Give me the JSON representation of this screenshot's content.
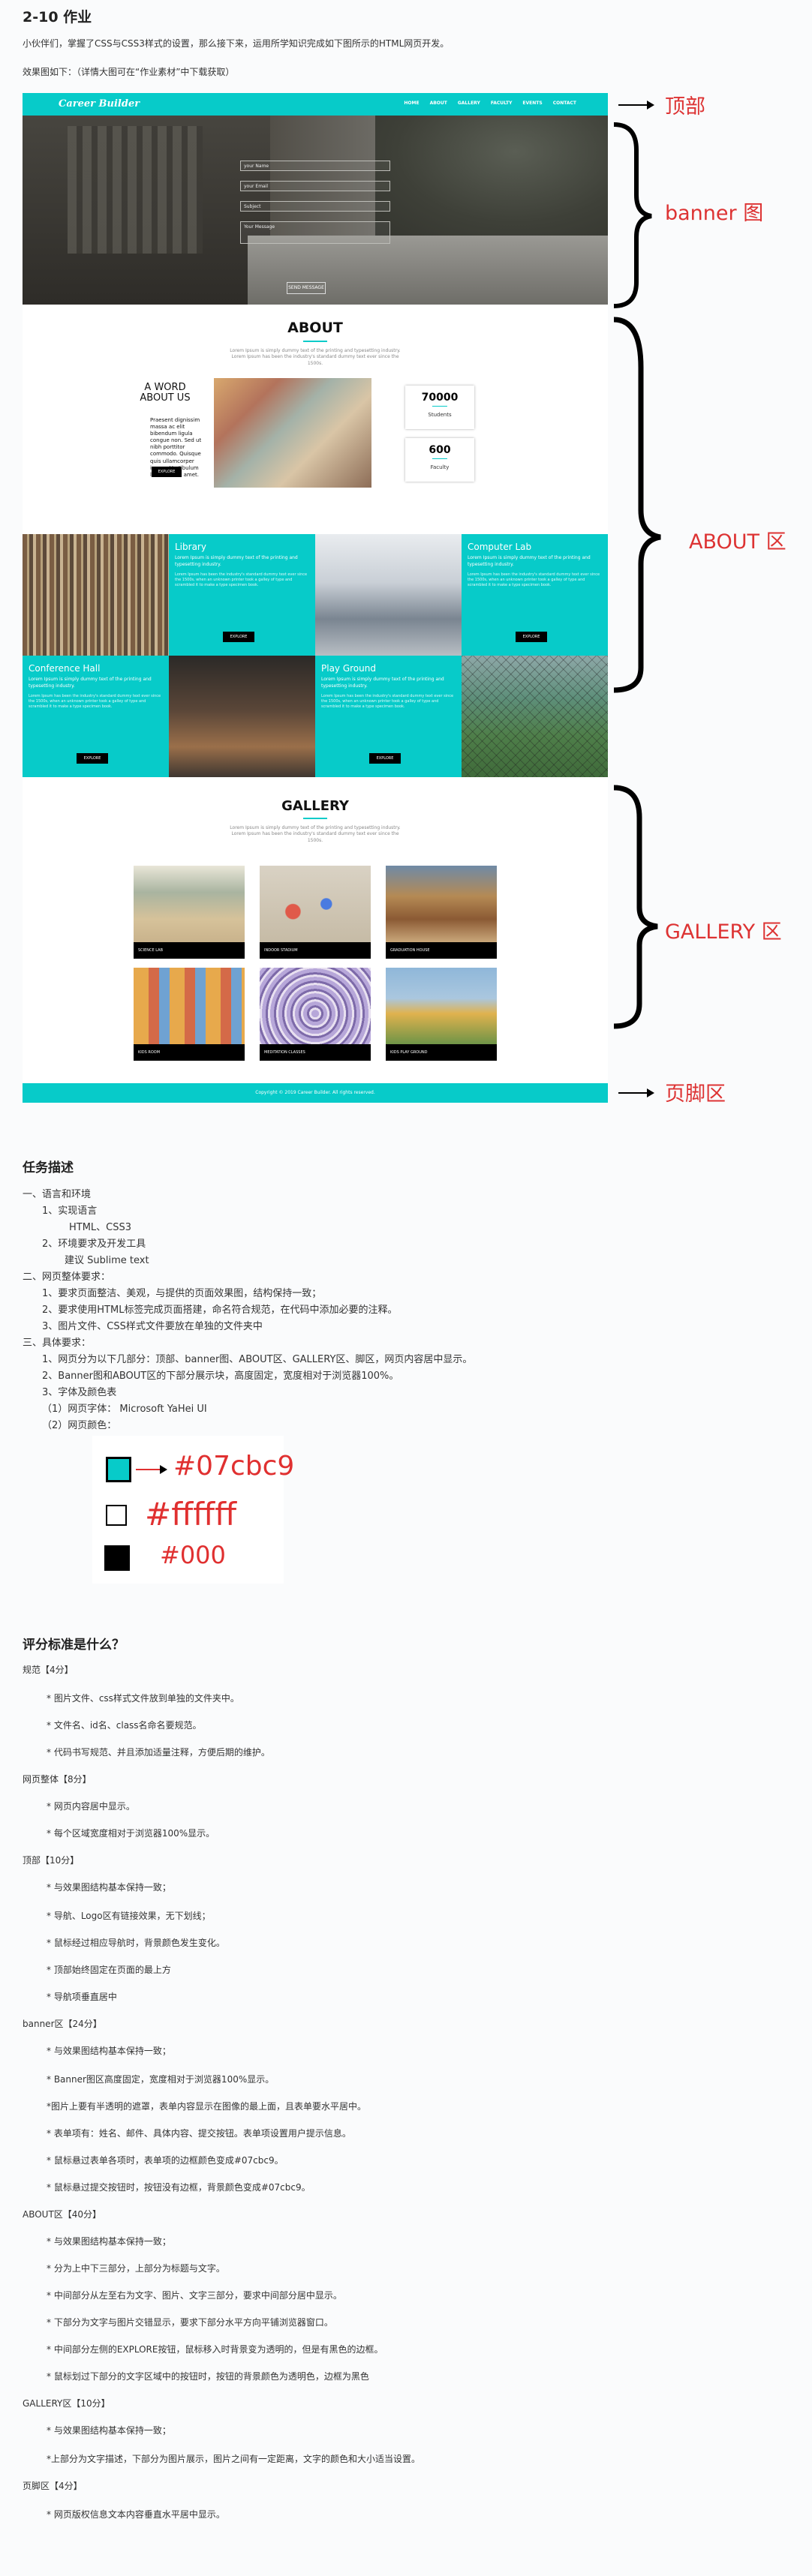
{
  "title": "2-10 作业",
  "intro": "小伙伴们，掌握了CSS与CSS3样式的设置，那么接下来，运用所学知识完成如下图所示的HTML网页开发。",
  "effect_label": "效果图如下：（详情大图可在“作业素材”中下载获取）",
  "mock": {
    "logo": "Career Builder",
    "nav": [
      "HOME",
      "ABOUT",
      "GALLERY",
      "FACULTY",
      "EVENTS",
      "CONTACT"
    ],
    "banner_fields": [
      "your Name",
      "your Email",
      "Subject",
      "Your Message"
    ],
    "banner_submit": "SEND MESSAGE",
    "about_title": "ABOUT",
    "about_sub": "Lorem Ipsum is simply dummy text of the printing and typesetting industry. Lorem Ipsum has been the industry's standard dummy text ever since the 1500s.",
    "word_title": "A WORD ABOUT US",
    "word_text": "Praesent dignissim massa ac elit bibendum ligula congue non. Sed ut nibh porttitor commodo. Quisque quis ullamcorper ipsum. Vestibulum lacinia diam amet.",
    "explore": "EXPLORE",
    "stats": [
      {
        "num": "70000",
        "label": "Students"
      },
      {
        "num": "600",
        "label": "Faculty"
      }
    ],
    "cells": [
      {
        "title": "Library",
        "sub": "Lorem Ipsum is simply dummy text of the printing and typesetting industry.",
        "para": "Lorem Ipsum has been the industry's standard dummy text ever since the 1500s, when an unknown printer took a galley of type and scrambled it to make a type specimen book.",
        "btn": "EXPLORE"
      },
      {
        "title": "Computer Lab",
        "sub": "Lorem Ipsum is simply dummy text of the printing and typesetting industry.",
        "para": "Lorem Ipsum has been the industry's standard dummy text ever since the 1500s, when an unknown printer took a galley of type and scrambled it to make a type specimen book.",
        "btn": "EXPLORE"
      },
      {
        "title": "Conference Hall",
        "sub": "Lorem Ipsum is simply dummy text of the printing and typesetting industry.",
        "para": "Lorem Ipsum has been the industry's standard dummy text ever since the 1500s, when an unknown printer took a galley of type and scrambled it to make a type specimen book.",
        "btn": "EXPLORE"
      },
      {
        "title": "Play Ground",
        "sub": "Lorem Ipsum is simply dummy text of the printing and typesetting industry.",
        "para": "Lorem Ipsum has been the industry's standard dummy text ever since the 1500s, when an unknown printer took a galley of type and scrambled it to make a type specimen book.",
        "btn": "EXPLORE"
      }
    ],
    "gallery_title": "GALLERY",
    "gallery_sub": "Lorem Ipsum is simply dummy text of the printing and typesetting industry. Lorem Ipsum has been the industry's standard dummy text ever since the 1500s.",
    "gallery": [
      "SCIENCE LAB",
      "INDOOR STADIUM",
      "GRADUATION HOUSE",
      "KIDS ROOM",
      "MEDITATION CLASSES",
      "KIDS PLAY GROUND"
    ],
    "footer": "Copyright © 2019 Career Builder. All rights reserved."
  },
  "annotations": {
    "top": "顶部",
    "banner": "banner 图",
    "about": "ABOUT 区",
    "gallery": "GALLERY 区",
    "footer": "页脚区"
  },
  "task": {
    "heading": "任务描述",
    "lines": [
      "一、语言和环境",
      "1、实现语言",
      "HTML、CSS3",
      "2、环境要求及开发工具",
      "建议 Sublime text",
      "二、网页整体要求：",
      "1、要求页面整洁、美观，与提供的页面效果图，结构保持一致；",
      "2、要求使用HTML标签完成页面搭建，命名符合规范，在代码中添加必要的注释。",
      "3、图片文件、CSS样式文件要放在单独的文件夹中",
      "三、具体要求：",
      "1、网页分为以下几部分：顶部、banner图、ABOUT区、GALLERY区、脚区，网页内容居中显示。",
      "2、Banner图和ABOUT区的下部分展示块，高度固定，宽度相对于浏览器100%。",
      "3、字体及颜色表",
      "（1）网页字体： Microsoft YaHei UI",
      "（2）网页颜色："
    ]
  },
  "colors": [
    {
      "hex": "#07cbc9",
      "label": "#07cbc9"
    },
    {
      "hex": "#ffffff",
      "label": "#ffffff"
    },
    {
      "hex": "#000000",
      "label": "#000"
    }
  ],
  "grading": {
    "heading": "评分标准是什么？",
    "lines": [
      "规范【4分】",
      "* 图片文件、css样式文件放到单独的文件夹中。",
      "* 文件名、id名、class名命名要规范。",
      "* 代码书写规范、并且添加适量注释，方便后期的维护。",
      "网页整体【8分】",
      "* 网页内容居中显示。",
      "* 每个区域宽度相对于浏览器100%显示。",
      "顶部【10分】",
      "* 与效果图结构基本保持一致；",
      "* 导航、Logo区有链接效果，无下划线；",
      "* 鼠标经过相应导航时，背景颜色发生变化。",
      "* 顶部始终固定在页面的最上方",
      "* 导航项垂直居中",
      "banner区【24分】",
      "* 与效果图结构基本保持一致；",
      "* Banner图区高度固定，宽度相对于浏览器100%显示。",
      "*图片上要有半透明的遮罩，表单内容显示在图像的最上面，且表单要水平居中。",
      "* 表单项有：姓名、邮件、具体内容、提交按钮。表单项设置用户提示信息。",
      "* 鼠标悬过表单各项时，表单项的边框颜色变成#07cbc9。",
      "* 鼠标悬过提交按钮时，按钮没有边框，背景颜色变成#07cbc9。",
      "ABOUT区【40分】",
      "* 与效果图结构基本保持一致；",
      "* 分为上中下三部分，上部分为标题与文字。",
      "* 中间部分从左至右为文字、图片、文字三部分，要求中间部分居中显示。",
      "* 下部分为文字与图片交错显示，要求下部分水平方向平铺浏览器窗口。",
      "* 中间部分左侧的EXPLORE按钮，鼠标移入时背景变为透明的，但是有黑色的边框。",
      "* 鼠标划过下部分的文字区域中的按钮时，按钮的背景颜色为透明色，边框为黑色",
      "GALLERY区【10分】",
      "* 与效果图结构基本保持一致；",
      "*上部分为文字描述，下部分为图片展示，图片之间有一定距离，文字的颜色和大小适当设置。",
      "页脚区【4分】",
      "* 网页版权信息文本内容垂直水平居中显示。"
    ]
  }
}
